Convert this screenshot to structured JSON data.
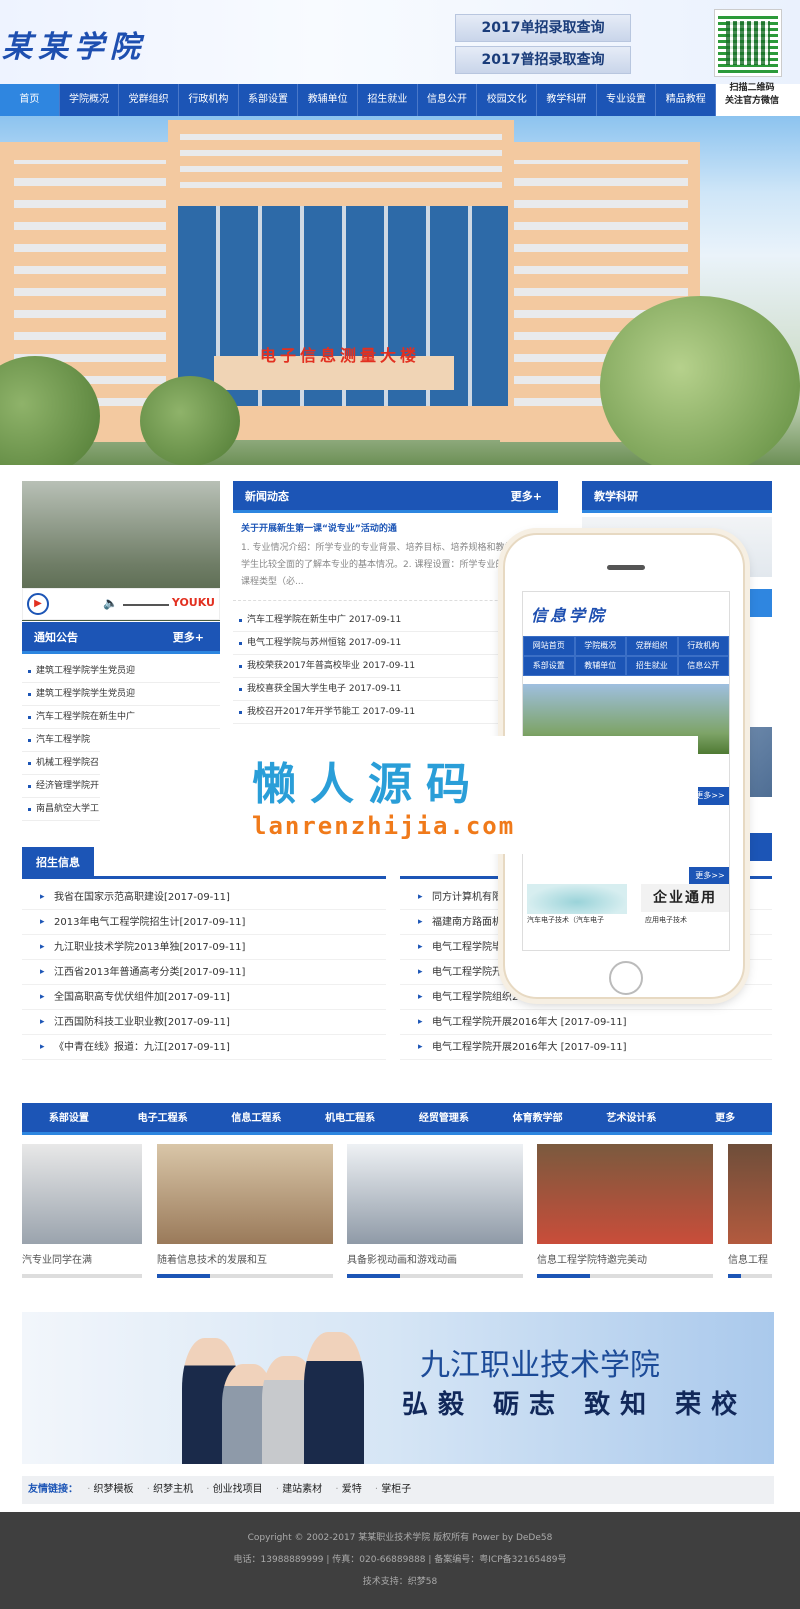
{
  "header": {
    "logo": "某某学院",
    "query_buttons": [
      "2017单招录取查询",
      "2017普招录取查询"
    ],
    "qr_caption": [
      "扫描二维码",
      "关注官方微信"
    ]
  },
  "nav": [
    "首页",
    "学院概况",
    "党群组织",
    "行政机构",
    "系部设置",
    "教辅单位",
    "招生就业",
    "信息公开",
    "校园文化",
    "教学科研",
    "专业设置",
    "精品教程"
  ],
  "banner": {
    "building_sign": "电子信息测量大楼"
  },
  "video": {
    "brand": "YOUKU"
  },
  "notice": {
    "title": "通知公告",
    "more": "更多+",
    "items": [
      "建筑工程学院学生党员迎",
      "建筑工程学院学生党员迎",
      "汽车工程学院在新生中广",
      "汽车工程学院",
      "机械工程学院召",
      "经济管理学院开",
      "南昌航空大学工"
    ]
  },
  "news": {
    "title": "新闻动态",
    "more": "更多+",
    "featured_title": "关于开展新生第一课“说专业”活动的通",
    "featured_summary": "1. 专业情况介绍：所学专业的专业背景、培养目标、培养规格和教学计划，让学生比较全面的了解本专业的基本情况。2. 课程设置：所学专业的课程体系、课程类型（必...",
    "items": [
      "汽车工程学院在新生中广 2017-09-11",
      "电气工程学院与苏州恒铭 2017-09-11",
      "我校荣获2017年普高校毕业 2017-09-11",
      "我校喜获全国大学生电子 2017-09-11",
      "我校召开2017年开学节能工 2017-09-11"
    ]
  },
  "teaching": {
    "title": "教学科研",
    "more": "更多>>"
  },
  "recruit": {
    "title": "招生信息",
    "left": [
      "我省在国家示范高职建设[2017-09-11]",
      "2013年电气工程学院招生计[2017-09-11]",
      "九江职业技术学院2013单独[2017-09-11]",
      "江西省2013年普通高考分类[2017-09-11]",
      "全国高职高专优伏组件加[2017-09-11]",
      "江西国防科技工业职业教[2017-09-11]",
      "《中青在线》报道：九江[2017-09-11]"
    ],
    "right": [
      "同方计算机有限公司",
      "福建南方路面机",
      "电气工程学院毕",
      "电气工程学院开",
      "电气工程学院组织2017届毕",
      "电气工程学院开展2016年大 [2017-09-11]",
      "电气工程学院开展2016年大 [2017-09-11]"
    ]
  },
  "dept": {
    "tabs": [
      "系部设置",
      "电子工程系",
      "信息工程系",
      "机电工程系",
      "经贸管理系",
      "体育教学部",
      "艺术设计系",
      "更多"
    ],
    "captions": [
      "汽专业同学在满",
      "随着信息技术的发展和互",
      "具备影视动画和游戏动画",
      "信息工程学院特邀完美动",
      "信息工程"
    ]
  },
  "ad": {
    "school": "九江职业技术学院",
    "motto": "弘毅 砺志 致知 荣校"
  },
  "links": {
    "label": "友情链接：",
    "items": [
      "织梦模板",
      "织梦主机",
      "创业找项目",
      "建站素材",
      "爱特",
      "掌柜子"
    ]
  },
  "footer": {
    "lines": [
      "Copyright © 2002-2017 某某职业技术学院 版权所有 Power by DeDe58",
      "电话：13988889999 | 传真：020-66889888 | 备案编号：粤ICP备32165489号",
      "技术支持：织梦58"
    ]
  },
  "phone": {
    "logo": "信息学院",
    "nav": [
      "网站首页",
      "学院概况",
      "党群组织",
      "行政机构",
      "系部设置",
      "教辅单位",
      "招生就业",
      "信息公开"
    ],
    "more": "更多>>",
    "card_left": "汽车电子技术（汽车电子",
    "card_right_img": "企业通用",
    "card_right": "应用电子技术"
  },
  "watermark": {
    "title": "懒人源码",
    "url": "lanrenzhijia.com"
  },
  "colors": {
    "primary": "#1c55b6",
    "accent": "#2f86e0",
    "footer": "#3f3f3f"
  }
}
